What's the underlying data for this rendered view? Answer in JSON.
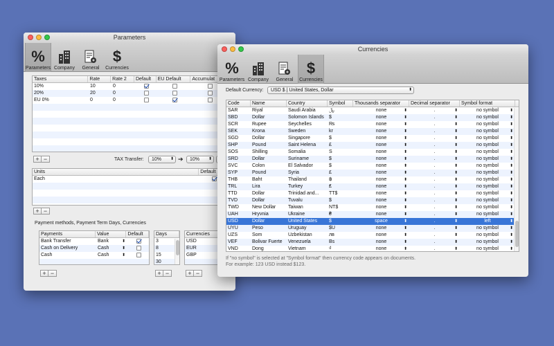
{
  "toolbar": {
    "parameters": "Parameters",
    "company": "Company",
    "general": "General",
    "currencies": "Currencies"
  },
  "params": {
    "title": "Parameters",
    "taxes": {
      "columns": [
        "Taxes",
        "Rate",
        "Rate 2",
        "Default",
        "EU Default",
        "Accumulat"
      ],
      "rows": [
        {
          "name": "10%",
          "rate": "10",
          "rate2": "0",
          "default": true,
          "eu": false,
          "acc": false
        },
        {
          "name": "20%",
          "rate": "20",
          "rate2": "0",
          "default": false,
          "eu": false,
          "acc": false
        },
        {
          "name": "EU 0%",
          "rate": "0",
          "rate2": "0",
          "default": false,
          "eu": true,
          "acc": false
        }
      ]
    },
    "tax_transfer_label": "TAX Transfer:",
    "tax_from": "10%",
    "tax_to": "10%",
    "arrow": "➔",
    "units": {
      "columns": [
        "Units",
        "Default"
      ],
      "rows": [
        {
          "name": "Each",
          "default": true
        }
      ]
    },
    "payment_section_label": "Payment methods, Payment Term Days, Currencies",
    "payments": {
      "columns": [
        "Payments",
        "Value",
        "Default"
      ],
      "rows": [
        {
          "name": "Bank Transfer",
          "value": "Bank",
          "default": true
        },
        {
          "name": "Cash on Delivery",
          "value": "Cash",
          "default": false
        },
        {
          "name": "Cash",
          "value": "Cash",
          "default": false
        }
      ]
    },
    "days": {
      "header": "Days",
      "rows": [
        "3",
        "8",
        "15",
        "30"
      ]
    },
    "currencies": {
      "header": "Currencies",
      "rows": [
        "USD",
        "EUR",
        "GBP"
      ]
    },
    "plus": "+",
    "minus": "−"
  },
  "curr": {
    "title": "Currencies",
    "default_currency_label": "Default Currency:",
    "default_currency_value": "USD $ | United States, Dollar",
    "columns": [
      "Code",
      "Name",
      "Country",
      "Symbol",
      "Thousands separator",
      "Decimal separator",
      "Symbol format"
    ],
    "rows": [
      {
        "code": "SAR",
        "name": "Riyal",
        "country": "Saudi Arabia",
        "symbol": "﷼",
        "thousands": "none",
        "decimal": ".",
        "format": "no symbol"
      },
      {
        "code": "SBD",
        "name": "Dollar",
        "country": "Solomon Islands",
        "symbol": "$",
        "thousands": "none",
        "decimal": ".",
        "format": "no symbol"
      },
      {
        "code": "SCR",
        "name": "Rupee",
        "country": "Seychelles",
        "symbol": "₨",
        "thousands": "none",
        "decimal": ".",
        "format": "no symbol"
      },
      {
        "code": "SEK",
        "name": "Krona",
        "country": "Sweden",
        "symbol": "kr",
        "thousands": "none",
        "decimal": ".",
        "format": "no symbol"
      },
      {
        "code": "SGD",
        "name": "Dollar",
        "country": "Singapore",
        "symbol": "$",
        "thousands": "none",
        "decimal": ".",
        "format": "no symbol"
      },
      {
        "code": "SHP",
        "name": "Pound",
        "country": "Saint Helena",
        "symbol": "£",
        "thousands": "none",
        "decimal": ".",
        "format": "no symbol"
      },
      {
        "code": "SOS",
        "name": "Shilling",
        "country": "Somalia",
        "symbol": "S",
        "thousands": "none",
        "decimal": ".",
        "format": "no symbol"
      },
      {
        "code": "SRD",
        "name": "Dollar",
        "country": "Suriname",
        "symbol": "$",
        "thousands": "none",
        "decimal": ".",
        "format": "no symbol"
      },
      {
        "code": "SVC",
        "name": "Colon",
        "country": "El Salvador",
        "symbol": "$",
        "thousands": "none",
        "decimal": ".",
        "format": "no symbol"
      },
      {
        "code": "SYP",
        "name": "Pound",
        "country": "Syria",
        "symbol": "£",
        "thousands": "none",
        "decimal": ".",
        "format": "no symbol"
      },
      {
        "code": "THB",
        "name": "Baht",
        "country": "Thailand",
        "symbol": "฿",
        "thousands": "none",
        "decimal": ".",
        "format": "no symbol"
      },
      {
        "code": "TRL",
        "name": "Lira",
        "country": "Turkey",
        "symbol": "₤",
        "thousands": "none",
        "decimal": ".",
        "format": "no symbol"
      },
      {
        "code": "TTD",
        "name": "Dollar",
        "country": "Trinidad and...",
        "symbol": "TT$",
        "thousands": "none",
        "decimal": ".",
        "format": "no symbol"
      },
      {
        "code": "TVD",
        "name": "Dollar",
        "country": "Tuvalu",
        "symbol": "$",
        "thousands": "none",
        "decimal": ".",
        "format": "no symbol"
      },
      {
        "code": "TWD",
        "name": "New Dollar",
        "country": "Taiwan",
        "symbol": "NT$",
        "thousands": "none",
        "decimal": ".",
        "format": "no symbol"
      },
      {
        "code": "UAH",
        "name": "Hryvnia",
        "country": "Ukraine",
        "symbol": "₴",
        "thousands": "none",
        "decimal": ".",
        "format": "no symbol"
      },
      {
        "code": "USD",
        "name": "Dollar",
        "country": "United States",
        "symbol": "$",
        "thousands": "space",
        "decimal": ".",
        "format": "left"
      },
      {
        "code": "UYU",
        "name": "Peso",
        "country": "Uruguay",
        "symbol": "$U",
        "thousands": "none",
        "decimal": ".",
        "format": "no symbol"
      },
      {
        "code": "UZS",
        "name": "Som",
        "country": "Uzbekistan",
        "symbol": "лв",
        "thousands": "none",
        "decimal": ".",
        "format": "no symbol"
      },
      {
        "code": "VEF",
        "name": "Bolivar Fuerte",
        "country": "Venezuela",
        "symbol": "Bs",
        "thousands": "none",
        "decimal": ".",
        "format": "no symbol"
      },
      {
        "code": "VND",
        "name": "Dong",
        "country": "Vietnam",
        "symbol": "₫",
        "thousands": "none",
        "decimal": ".",
        "format": "no symbol"
      }
    ],
    "selected_code": "USD",
    "note_line1": "If \"no symbol\" is selected at \"Symbol format\" then currency code appears on documents.",
    "note_line2": "For example: 123 USD instead $123."
  }
}
